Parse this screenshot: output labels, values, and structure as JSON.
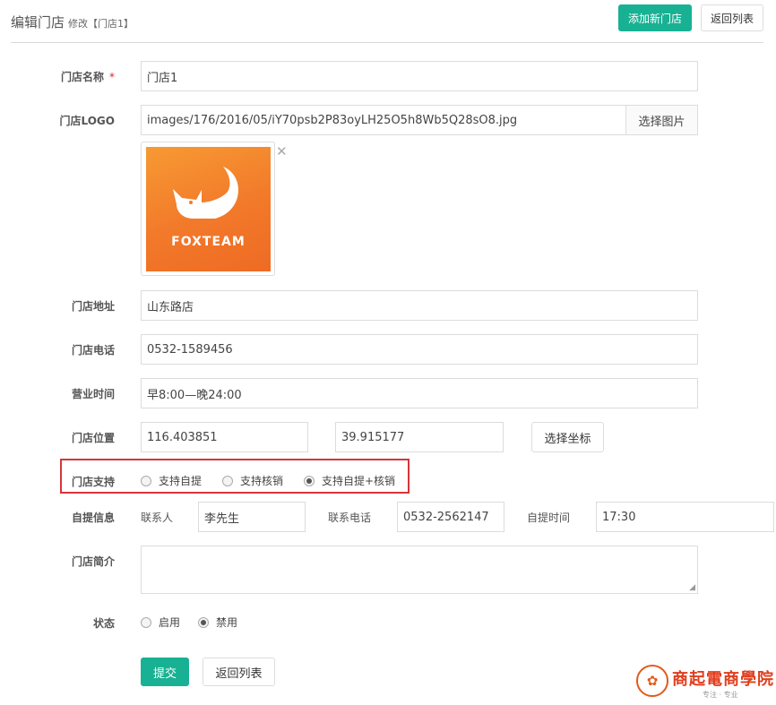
{
  "header": {
    "title": "编辑门店",
    "subtitle": "修改【门店1】",
    "add_button": "添加新门店",
    "back_button": "返回列表"
  },
  "form": {
    "name": {
      "label": "门店名称",
      "required_mark": "*",
      "value": "门店1"
    },
    "logo": {
      "label": "门店LOGO",
      "value": "images/176/2016/05/iY70psb2P83oyLH25O5h8Wb5Q28sO8.jpg",
      "select_button": "选择图片",
      "preview_text": "FOXTEAM",
      "remove_icon": "close-icon"
    },
    "address": {
      "label": "门店地址",
      "value": "山东路店"
    },
    "phone": {
      "label": "门店电话",
      "value": "0532-1589456"
    },
    "hours": {
      "label": "营业时间",
      "value": "早8:00—晚24:00"
    },
    "location": {
      "label": "门店位置",
      "lng": "116.403851",
      "lat": "39.915177",
      "select_button": "选择坐标"
    },
    "support": {
      "label": "门店支持",
      "options": [
        {
          "label": "支持自提",
          "checked": false
        },
        {
          "label": "支持核销",
          "checked": false
        },
        {
          "label": "支持自提+核销",
          "checked": true
        }
      ]
    },
    "pickup": {
      "label": "自提信息",
      "contact_label": "联系人",
      "contact_value": "李先生",
      "phone_label": "联系电话",
      "phone_value": "0532-2562147",
      "time_label": "自提时间",
      "time_value": "17:30"
    },
    "intro": {
      "label": "门店简介",
      "value": ""
    },
    "status": {
      "label": "状态",
      "options": [
        {
          "label": "启用",
          "checked": false
        },
        {
          "label": "禁用",
          "checked": true
        }
      ]
    },
    "submit_button": "提交",
    "back_button": "返回列表"
  },
  "watermark": {
    "title": "商起電商學院",
    "subtitle": "专注 · 专业"
  },
  "colors": {
    "primary": "#18b193",
    "highlight": "#d6353a",
    "logo_orange": "#f2792a"
  }
}
